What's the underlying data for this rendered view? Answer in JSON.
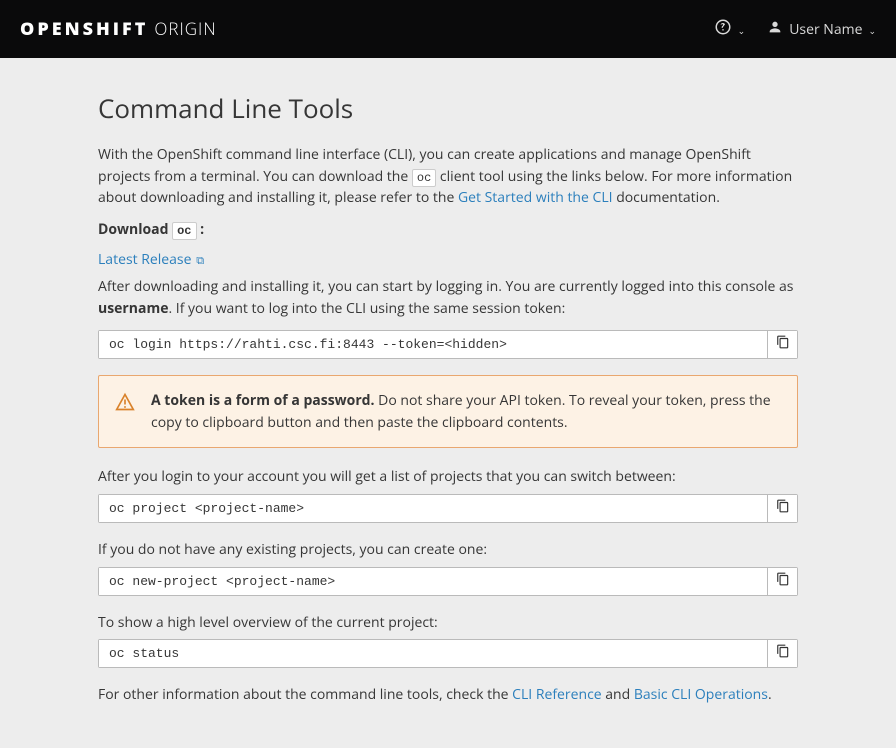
{
  "header": {
    "brand_bold": "OPENSHIFT",
    "brand_light": "ORIGIN",
    "user_label": "User Name"
  },
  "page": {
    "title": "Command Line Tools",
    "intro_part1": "With the OpenShift command line interface (CLI), you can create applications and manage OpenShift projects from a terminal. You can download the ",
    "intro_code": "oc",
    "intro_part2": " client tool using the links below. For more information about downloading and installing it, please refer to the ",
    "intro_link": "Get Started with the CLI",
    "intro_part3": " documentation.",
    "download_label": "Download ",
    "download_code": "oc",
    "download_colon": " :",
    "latest_release": "Latest Release",
    "login_intro_a": "After downloading and installing it, you can start by logging in. You are currently logged into this console as ",
    "login_user": "username",
    "login_intro_b": ". If you want to log into the CLI using the same session token:",
    "cmd_login": "oc login https://rahti.csc.fi:8443 --token=<hidden>",
    "warn_bold": "A token is a form of a password.",
    "warn_rest": " Do not share your API token. To reveal your token, press the copy to clipboard button and then paste the clipboard contents.",
    "projects_intro": "After you login to your account you will get a list of projects that you can switch between:",
    "cmd_project": "oc project <project-name>",
    "new_proj_intro": "If you do not have any existing projects, you can create one:",
    "cmd_new_project": "oc new-project <project-name>",
    "status_intro": "To show a high level overview of the current project:",
    "cmd_status": "oc status",
    "footer_a": "For other information about the command line tools, check the ",
    "footer_link1": "CLI Reference",
    "footer_and": " and ",
    "footer_link2": "Basic CLI Operations",
    "footer_dot": "."
  }
}
